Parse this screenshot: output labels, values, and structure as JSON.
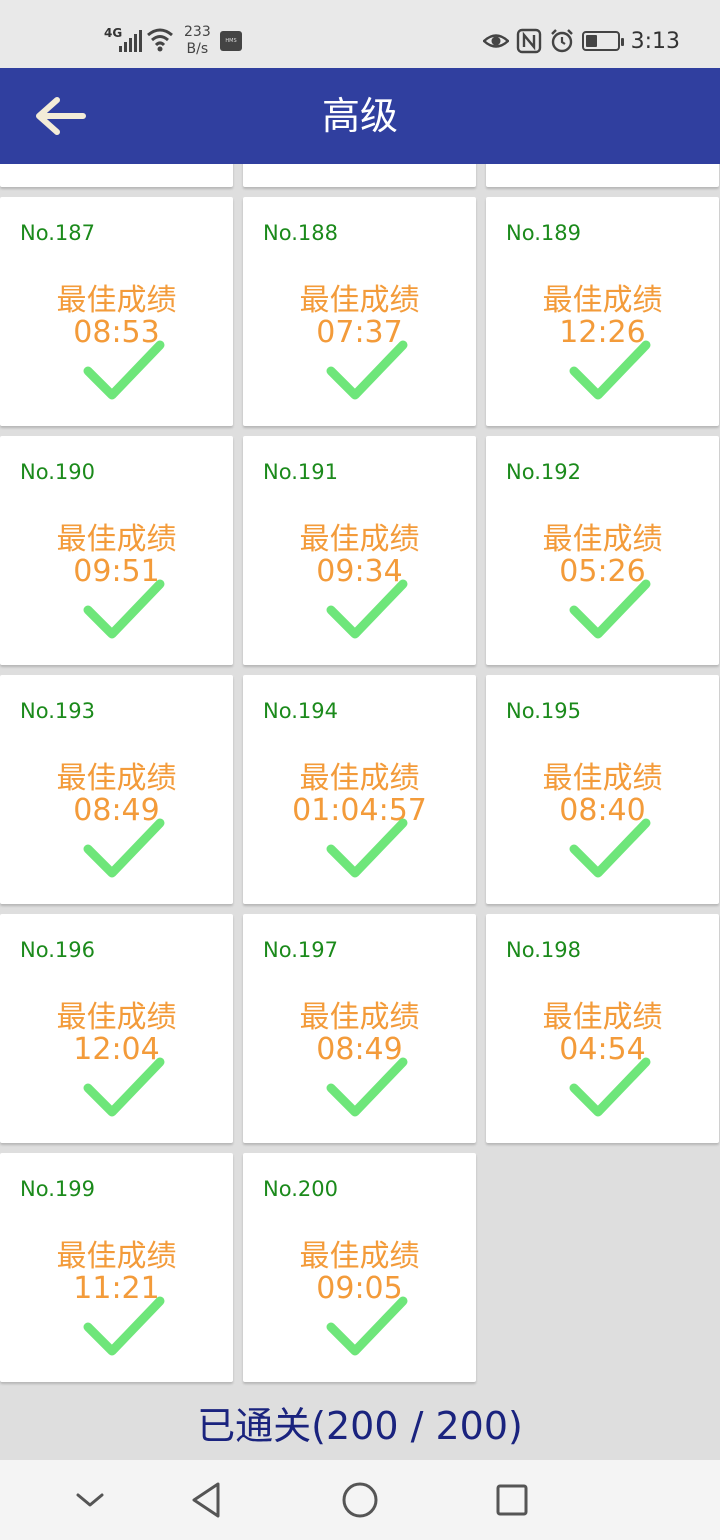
{
  "status_bar": {
    "network_type": "4G",
    "speed_value": "233",
    "speed_unit": "B/s",
    "hms_label": "HMS",
    "battery_level": 0.35,
    "time": "3:13"
  },
  "app_bar": {
    "title": "高级",
    "back_icon": "arrow-left-icon"
  },
  "levels": [
    {
      "no": "",
      "label": "",
      "time": "",
      "completed": false,
      "partial": true
    },
    {
      "no": "",
      "label": "",
      "time": "",
      "completed": false,
      "partial": true
    },
    {
      "no": "",
      "label": "",
      "time": "",
      "completed": false,
      "partial": true
    },
    {
      "no": "No.187",
      "label": "最佳成绩",
      "time": "08:53",
      "completed": true
    },
    {
      "no": "No.188",
      "label": "最佳成绩",
      "time": "07:37",
      "completed": true
    },
    {
      "no": "No.189",
      "label": "最佳成绩",
      "time": "12:26",
      "completed": true
    },
    {
      "no": "No.190",
      "label": "最佳成绩",
      "time": "09:51",
      "completed": true
    },
    {
      "no": "No.191",
      "label": "最佳成绩",
      "time": "09:34",
      "completed": true
    },
    {
      "no": "No.192",
      "label": "最佳成绩",
      "time": "05:26",
      "completed": true
    },
    {
      "no": "No.193",
      "label": "最佳成绩",
      "time": "08:49",
      "completed": true
    },
    {
      "no": "No.194",
      "label": "最佳成绩",
      "time": "01:04:57",
      "completed": true
    },
    {
      "no": "No.195",
      "label": "最佳成绩",
      "time": "08:40",
      "completed": true
    },
    {
      "no": "No.196",
      "label": "最佳成绩",
      "time": "12:04",
      "completed": true
    },
    {
      "no": "No.197",
      "label": "最佳成绩",
      "time": "08:49",
      "completed": true
    },
    {
      "no": "No.198",
      "label": "最佳成绩",
      "time": "04:54",
      "completed": true
    },
    {
      "no": "No.199",
      "label": "最佳成绩",
      "time": "11:21",
      "completed": true
    },
    {
      "no": "No.200",
      "label": "最佳成绩",
      "time": "09:05",
      "completed": true
    }
  ],
  "progress_text": "已通关(200 / 200)",
  "colors": {
    "app_bar": "#303f9f",
    "level_number": "#1b8a1b",
    "best_score": "#f39b3a",
    "check": "#6ee67a",
    "progress_text": "#1a237e"
  },
  "nav_bar": {
    "buttons": [
      "chevron-down-icon",
      "back-triangle-icon",
      "home-circle-icon",
      "recents-square-icon"
    ]
  }
}
